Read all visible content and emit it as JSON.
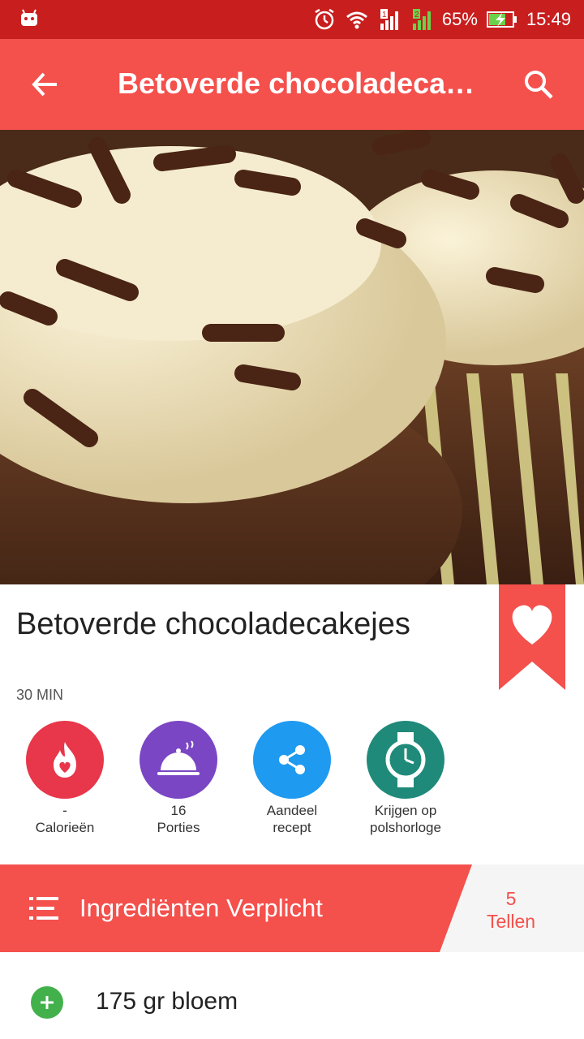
{
  "status_bar": {
    "battery": "65%",
    "time": "15:49"
  },
  "app_bar": {
    "title": "Betoverde chocoladecakejes"
  },
  "recipe": {
    "title": "Betoverde chocoladecakejes",
    "time": "30 MIN"
  },
  "actions": [
    {
      "line1": "-",
      "line2": "Calorieën",
      "icon": "flame-heart-icon",
      "color": "#e8364a"
    },
    {
      "line1": "16",
      "line2": "Porties",
      "icon": "cloche-icon",
      "color": "#7a46c4"
    },
    {
      "line1": "Aandeel",
      "line2": "recept",
      "icon": "share-icon",
      "color": "#1e9af0"
    },
    {
      "line1": "Krijgen op",
      "line2": "polshorloge",
      "icon": "watch-icon",
      "color": "#1f8a7a"
    }
  ],
  "ingredients": {
    "header": "Ingrediënten Verplicht",
    "count": "5",
    "count_label": "Tellen"
  },
  "ingredient_items": [
    {
      "text": "175 gr bloem"
    }
  ],
  "colors": {
    "accent": "#f4504c",
    "status_bar": "#c81e1e",
    "add": "#43b14b"
  }
}
